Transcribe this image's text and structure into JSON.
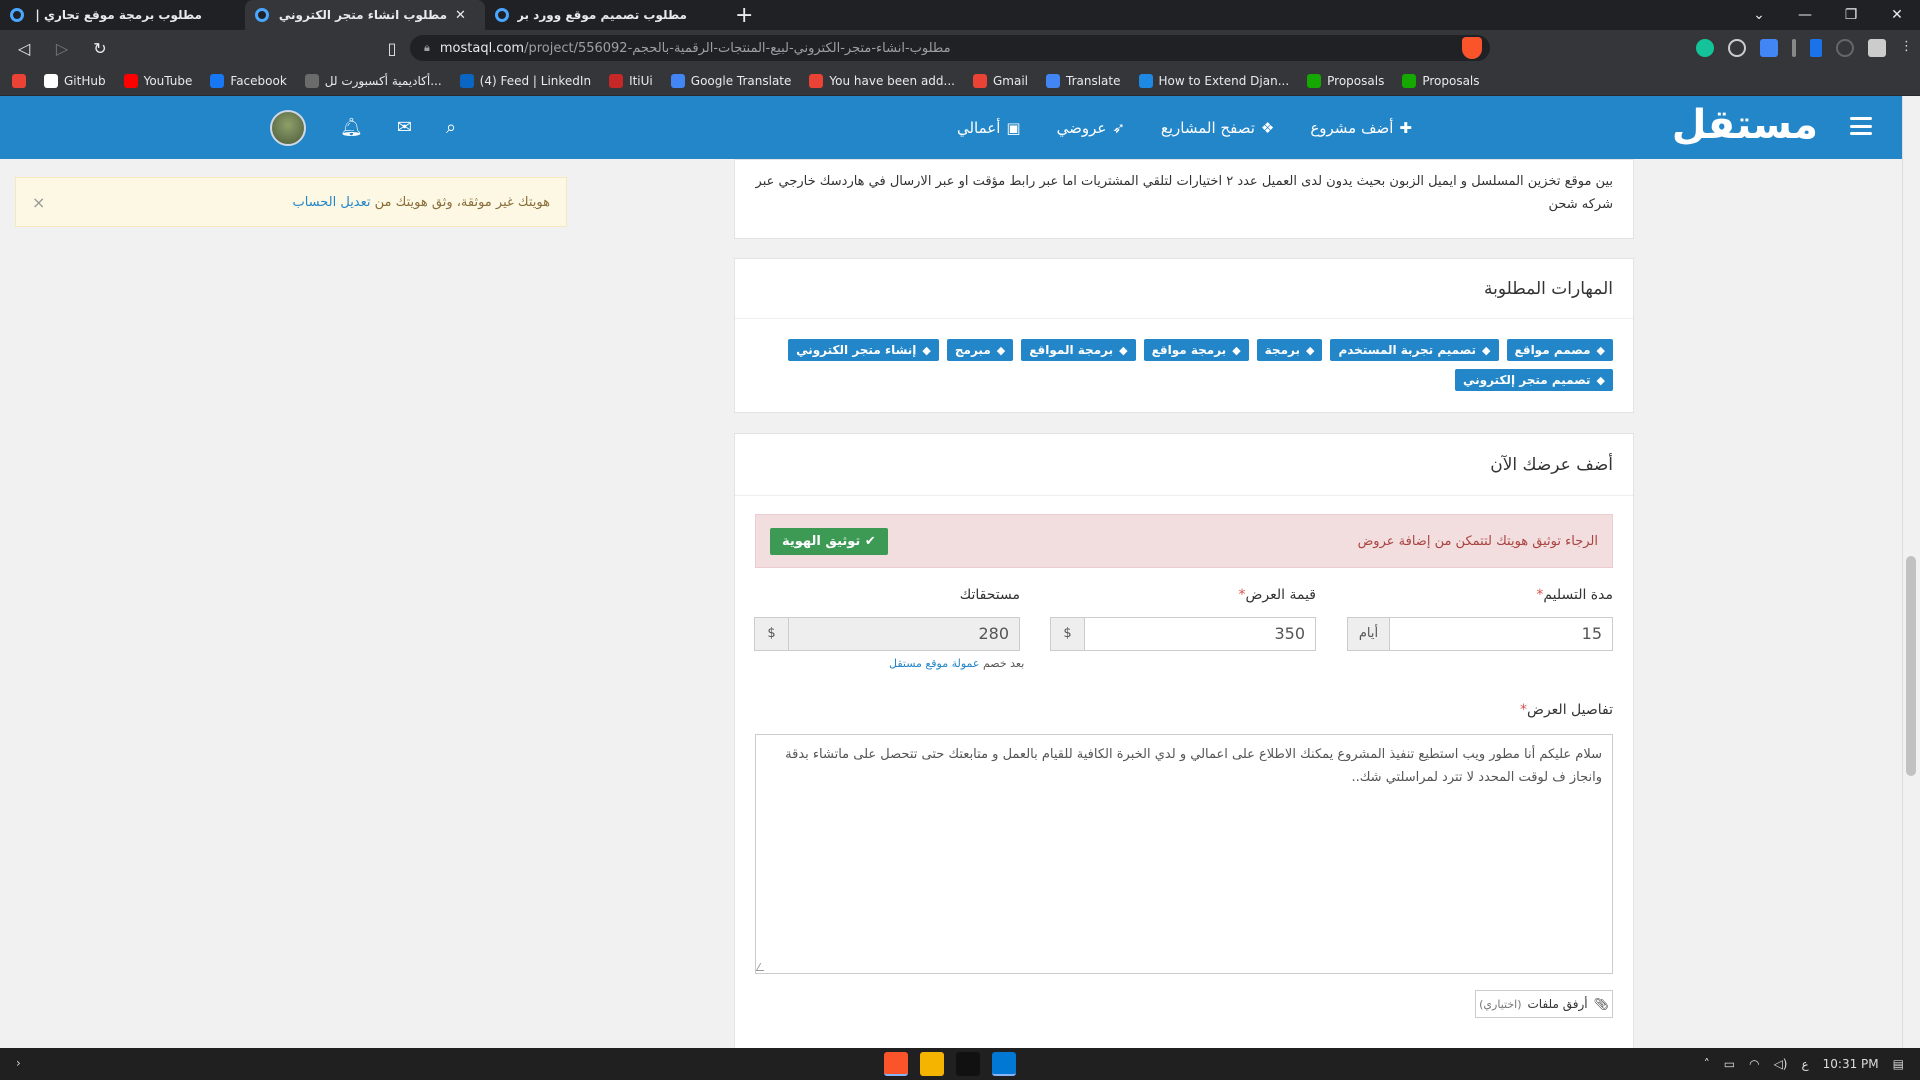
{
  "browser": {
    "tabs": [
      {
        "title": "مطلوب برمجة موقع تجاري | مستقل",
        "active": false
      },
      {
        "title": "مطلوب انشاء متجر الكتروني لبيع المنتجات الرقمية",
        "active": true
      },
      {
        "title": "مطلوب تصميم موقع وورد بريس | مستقل",
        "active": false
      }
    ],
    "new_tab": "+",
    "window_controls": [
      "⌄",
      "—",
      "❐",
      "✕"
    ],
    "url_domain": "mostaql.com",
    "url_path": "/project/556092-مطلوب-انشاء-متجر-الكتروني-لبيع-المنتجات-الرقمية-بالحجم",
    "bookmarks": [
      {
        "label": "",
        "icon": "google-icon",
        "color": "#ea4335"
      },
      {
        "label": "GitHub",
        "icon": "github-icon",
        "color": "#ffffff"
      },
      {
        "label": "YouTube",
        "icon": "youtube-icon",
        "color": "#ff0000"
      },
      {
        "label": "Facebook",
        "icon": "facebook-icon",
        "color": "#1877f2"
      },
      {
        "label": "أكاديمية أكسبورت لل...",
        "icon": "academy-icon",
        "color": "#6b6b6b"
      },
      {
        "label": "(4) Feed | LinkedIn",
        "icon": "linkedin-icon",
        "color": "#0a66c2"
      },
      {
        "label": "ItiUi",
        "icon": "itiui-icon",
        "color": "#c62828"
      },
      {
        "label": "Google Translate",
        "icon": "translate-icon",
        "color": "#4285f4"
      },
      {
        "label": "You have been add...",
        "icon": "gmail-icon",
        "color": "#ea4335"
      },
      {
        "label": "Gmail",
        "icon": "gmail-icon",
        "color": "#ea4335"
      },
      {
        "label": "Translate",
        "icon": "translate-icon",
        "color": "#4285f4"
      },
      {
        "label": "How to Extend Djan...",
        "icon": "stackoverflow-icon",
        "color": "#1e88e5"
      },
      {
        "label": "Proposals",
        "icon": "upwork-icon",
        "color": "#14a800"
      },
      {
        "label": "Proposals",
        "icon": "upwork-icon",
        "color": "#14a800"
      }
    ]
  },
  "header": {
    "logo": "مستقل",
    "nav": [
      {
        "label": "أضف مشروع",
        "icon": "plus-icon",
        "glyph": "✚"
      },
      {
        "label": "تصفح المشاريع",
        "icon": "cubes-icon",
        "glyph": "❖"
      },
      {
        "label": "عروضي",
        "icon": "rocket-icon",
        "glyph": "➶"
      },
      {
        "label": "أعمالي",
        "icon": "briefcase-icon",
        "glyph": "▣"
      }
    ],
    "brand_color": "#2386c8"
  },
  "identity_alert": {
    "text": "هويتك غير موثقة، وثق هويتك من ",
    "link": "تعديل الحساب",
    "close": "×"
  },
  "project_description": "بين موقع تخزين المسلسل و ايميل الزبون بحيث يدون لدى العميل عدد ٢ اختيارات لتلقي المشتريات اما عبر رابط مؤقت او عبر الارسال في هاردسك خارجي عبر شركه شحن",
  "skills": {
    "title": "المهارات المطلوبة",
    "tags": [
      "مصمم مواقع",
      "تصميم تجربة المستخدم",
      "برمجة",
      "برمجة مواقع",
      "برمجة المواقع",
      "مبرمج",
      "إنشاء متجر الكتروني",
      "تصميم متجر إلكتروني"
    ]
  },
  "offer": {
    "title": "أضف عرضك الآن",
    "verify_message": "الرجاء توثيق هويتك لتتمكن من إضافة عروض",
    "verify_button": "توثيق الهوية",
    "delivery_label": "مدة التسليم",
    "delivery_value": "15",
    "delivery_unit": "أيام",
    "price_label": "قيمة العرض",
    "price_value": "350",
    "price_unit": "$",
    "earnings_label": "مستحقاتك",
    "earnings_value": "280",
    "earnings_unit": "$",
    "commission_prefix": "بعد خصم ",
    "commission_link": "عمولة موقع مستقل",
    "required_mark": "*",
    "details_label": "تفاصيل العرض",
    "details_text": "سلام عليكم أنا مطور ويب استطيع تنفيذ المشروع يمكنك الاطلاع على اعمالي و لدي الخبرة الكافية للقيام بالعمل و متابعتك حتى تتحصل على ماتشاء بدقة وانجاز ف لوقت المحدد  لا تترد لمراسلتي شك..",
    "attach_label": "أرفق ملفات",
    "attach_optional": "(اختياري)"
  },
  "taskbar": {
    "time": "10:31 PM",
    "lang": "ع",
    "apps": [
      {
        "icon": "brave-icon",
        "color": "#fb542b"
      },
      {
        "icon": "file-explorer-icon",
        "color": "#f4b400"
      },
      {
        "icon": "pycharm-icon",
        "color": "#111111"
      },
      {
        "icon": "vscode-icon",
        "color": "#0078d4"
      }
    ]
  }
}
